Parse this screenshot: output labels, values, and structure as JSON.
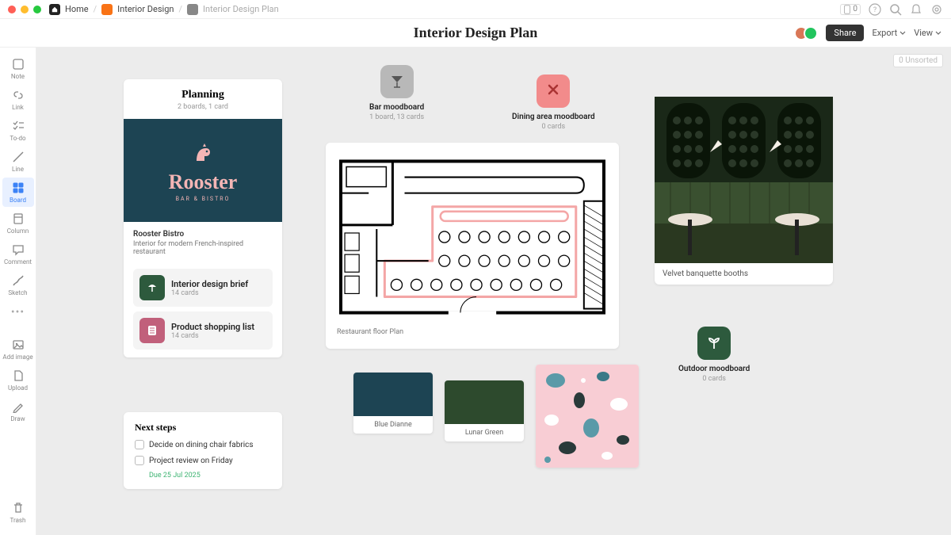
{
  "topbar": {
    "home": "Home",
    "crumb1": "Interior Design",
    "crumb2": "Interior Design Plan",
    "badge_count": "0"
  },
  "header": {
    "title": "Interior Design Plan",
    "share": "Share",
    "export": "Export",
    "views": "View"
  },
  "sidebar": {
    "note": "Note",
    "link": "Link",
    "todo": "To-do",
    "line": "Line",
    "board": "Board",
    "column": "Column",
    "comment": "Comment",
    "sketch": "Sketch",
    "addimage": "Add image",
    "upload": "Upload",
    "draw": "Draw",
    "trash": "Trash"
  },
  "unsorted": {
    "count": "0",
    "label": "Unsorted"
  },
  "planning": {
    "title": "Planning",
    "subtitle": "2 boards, 1 card",
    "brand_name": "Rooster",
    "brand_sub": "BAR & BISTRO",
    "rooster_title": "Rooster Bistro",
    "rooster_desc": "Interior for modern French-inspired restaurant",
    "brief": {
      "title": "Interior design brief",
      "count": "14 cards"
    },
    "shopping": {
      "title": "Product shopping list",
      "count": "14 cards"
    }
  },
  "next": {
    "title": "Next steps",
    "item1": "Decide on dining chair fabrics",
    "item2": "Project review on Friday",
    "due": "Due 25 Jul 2025"
  },
  "mood": {
    "bar": {
      "title": "Bar moodboard",
      "count": "1 board, 13 cards"
    },
    "dining": {
      "title": "Dining area moodboard",
      "count": "0 cards"
    },
    "outdoor": {
      "title": "Outdoor moodboard",
      "count": "0 cards"
    }
  },
  "floorplan": {
    "caption": "Restaurant floor Plan"
  },
  "swatches": {
    "blue": "Blue Dianne",
    "green": "Lunar Green"
  },
  "photo": {
    "caption": "Velvet banquette booths"
  }
}
